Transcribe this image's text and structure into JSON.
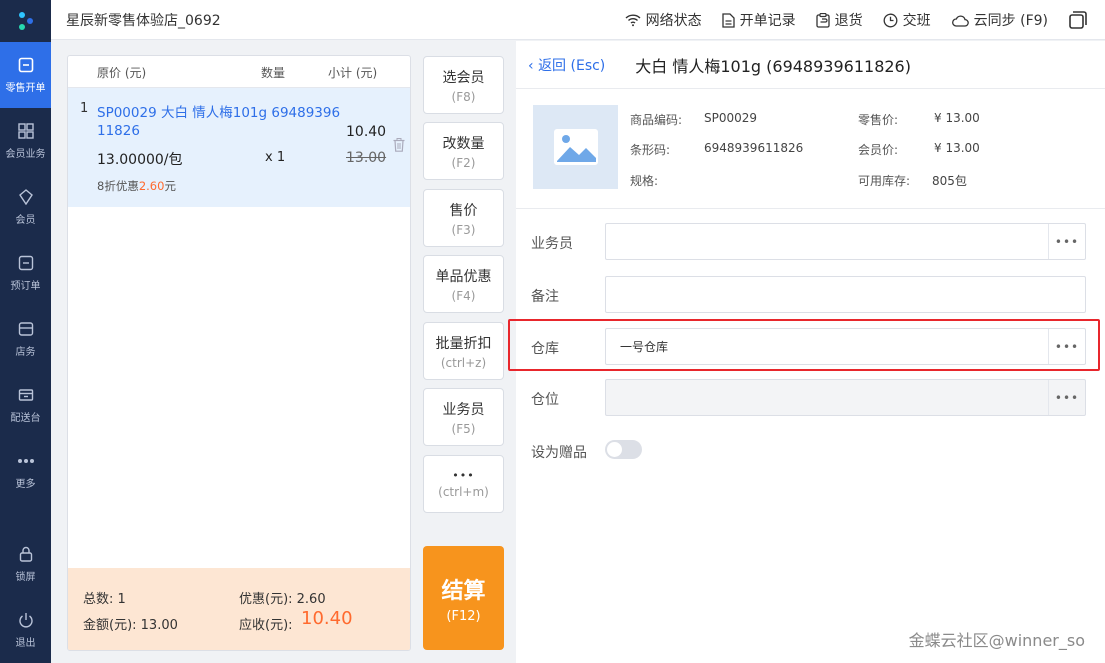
{
  "sidebar": {
    "items": [
      {
        "label": "零售开单",
        "icon": "receipt-icon",
        "active": true
      },
      {
        "label": "会员业务",
        "icon": "grid-icon"
      },
      {
        "label": "会员",
        "icon": "member-icon"
      },
      {
        "label": "预订单",
        "icon": "order-icon"
      },
      {
        "label": "店务",
        "icon": "store-icon"
      },
      {
        "label": "配送台",
        "icon": "delivery-icon"
      },
      {
        "label": "更多",
        "icon": "more-icon"
      }
    ],
    "bottom": [
      {
        "label": "锁屏",
        "icon": "lock-icon"
      },
      {
        "label": "退出",
        "icon": "power-icon"
      }
    ]
  },
  "topbar": {
    "store_name": "星辰新零售体验店_0692",
    "network": "网络状态",
    "records": "开单记录",
    "returns": "退货",
    "shift": "交班",
    "sync": "云同步 (F9)"
  },
  "cart": {
    "headers": {
      "price": "原价 (元)",
      "qty": "数量",
      "subtotal": "小计 (元)"
    },
    "item": {
      "index": "1",
      "name_line1": "SP00029 大白 情人梅101g 69489396",
      "name_line2": "11826",
      "subtotal": "10.40",
      "unit_price": "13.00000/包",
      "qty": "x 1",
      "original": "13.00",
      "discount_prefix": "8折优惠",
      "discount_value": "2.60",
      "discount_suffix": "元"
    },
    "footer": {
      "total_count_label": "总数: 1",
      "discount_label": "优惠(元): 2.60",
      "amount_label": "金额(元): 13.00",
      "receivable_label": "应收(元):",
      "receivable_value": "10.40"
    }
  },
  "functions": [
    {
      "label": "选会员",
      "key": "(F8)"
    },
    {
      "label": "改数量",
      "key": "(F2)"
    },
    {
      "label": "售价",
      "key": "(F3)"
    },
    {
      "label": "单品优惠",
      "key": "(F4)"
    },
    {
      "label": "批量折扣",
      "key": "(ctrl+z)"
    },
    {
      "label": "业务员",
      "key": "(F5)"
    },
    {
      "label": "•••",
      "key": "(ctrl+m)"
    }
  ],
  "checkout": {
    "label": "结算",
    "key": "(F12)"
  },
  "detail": {
    "back": "返回 (Esc)",
    "title": "大白 情人梅101g (6948939611826)",
    "code_label": "商品编码:",
    "code_value": "SP00029",
    "barcode_label": "条形码:",
    "barcode_value": "6948939611826",
    "spec_label": "规格:",
    "retail_label": "零售价:",
    "retail_value": "¥ 13.00",
    "member_label": "会员价:",
    "member_value": "¥ 13.00",
    "stock_label": "可用库存:",
    "stock_value": "805包",
    "salesman_label": "业务员",
    "remark_label": "备注",
    "warehouse_label": "仓库",
    "warehouse_value": "一号仓库",
    "location_label": "仓位",
    "gift_label": "设为赠品",
    "gift_on": false,
    "more": "•••"
  },
  "watermark": "金蝶云社区@winner_so",
  "colors": {
    "sidebar": "#1b2b4b",
    "accent": "#2e6fe8",
    "checkout": "#f7941d",
    "highlight": "#e8262c",
    "discount": "#ff6a2e"
  }
}
